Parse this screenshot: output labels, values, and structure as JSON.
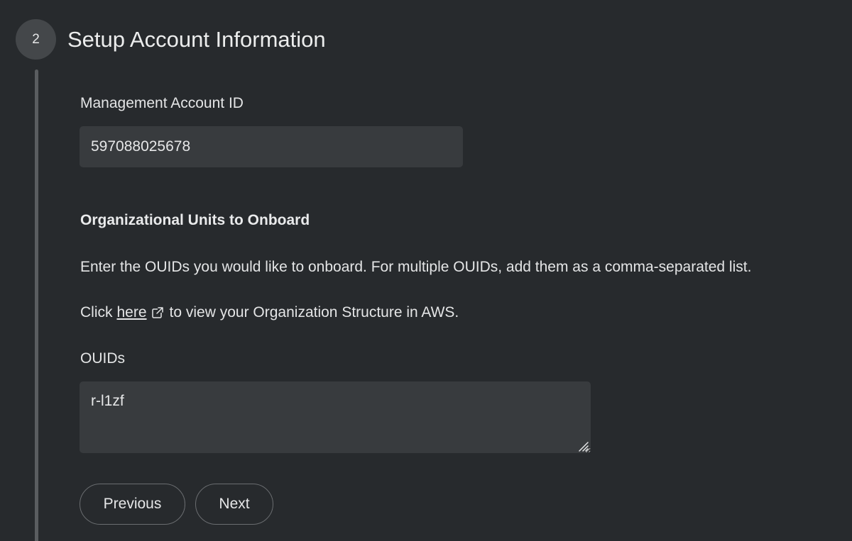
{
  "step": {
    "number": "2",
    "title": "Setup Account Information"
  },
  "management_account": {
    "label": "Management Account ID",
    "value": "597088025678"
  },
  "org_units": {
    "heading": "Organizational Units to Onboard",
    "description": "Enter the OUIDs you would like to onboard. For multiple OUIDs, add them as a comma-separated list.",
    "link_prefix": "Click",
    "link_text": "here",
    "link_suffix": "to view your Organization Structure in AWS.",
    "ouids_label": "OUIDs",
    "ouids_value": "r-l1zf"
  },
  "buttons": {
    "previous": "Previous",
    "next": "Next"
  },
  "icons": {
    "external_link": "external-link-icon",
    "resize": "resize-handle-icon"
  },
  "colors": {
    "background": "#272a2d",
    "input_background": "#383b3e",
    "step_badge": "#44474a",
    "step_line": "#5a5d60"
  }
}
